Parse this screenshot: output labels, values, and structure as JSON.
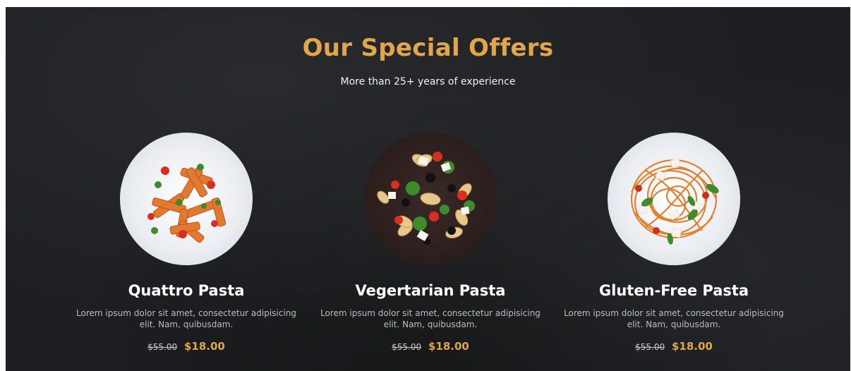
{
  "header": {
    "title": "Our Special Offers",
    "subtitle": "More than 25+ years of experience"
  },
  "accent_color": "#e2a64a",
  "offers": [
    {
      "name": "Quattro Pasta",
      "description": "Lorem ipsum dolor sit amet, consectetur adipisicing elit. Nam, quibusdam.",
      "old_price": "$55.00",
      "new_price": "$18.00",
      "image": "penne-pasta-plate-image"
    },
    {
      "name": "Vegertarian Pasta",
      "description": "Lorem ipsum dolor sit amet, consectetur adipisicing elit. Nam, quibusdam.",
      "old_price": "$55.00",
      "new_price": "$18.00",
      "image": "vegetable-pasta-salad-bowl-image"
    },
    {
      "name": "Gluten-Free Pasta",
      "description": "Lorem ipsum dolor sit amet, consectetur adipisicing elit. Nam, quibusdam.",
      "old_price": "$55.00",
      "new_price": "$18.00",
      "image": "spaghetti-plate-image"
    }
  ]
}
